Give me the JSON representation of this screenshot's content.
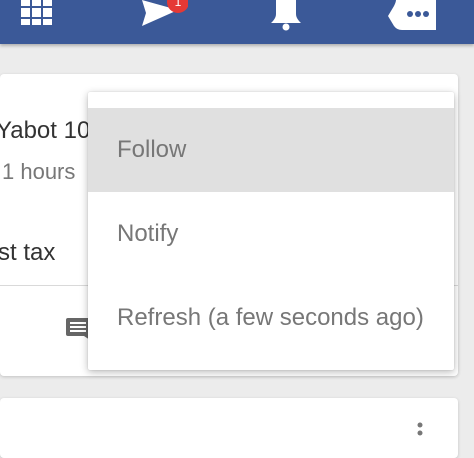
{
  "header": {
    "notification_badge": "1",
    "bar_color": "#3b5998",
    "icons": [
      "apps-grid-icon",
      "send-icon",
      "bell-icon",
      "messages-icon"
    ]
  },
  "post": {
    "author": "Yabot 10",
    "time": "1 hours",
    "text": "st tax"
  },
  "menu": {
    "items": [
      {
        "label": "Follow",
        "highlighted": true
      },
      {
        "label": "Notify",
        "highlighted": false
      },
      {
        "label": "Refresh (a few seconds ago)",
        "highlighted": false
      }
    ]
  }
}
